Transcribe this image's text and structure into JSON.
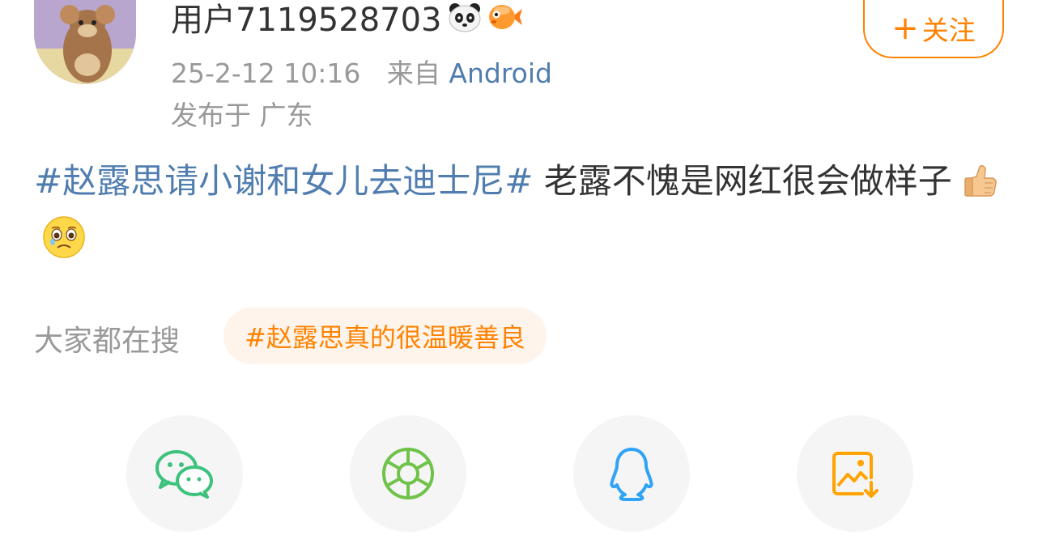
{
  "post": {
    "username": "用户7119528703",
    "timestamp": "25-2-12 10:16",
    "from_label": "来自",
    "source": "Android",
    "location": "发布于 广东",
    "topic": "#赵露思请小谢和女儿去迪士尼#",
    "body": " 老露不愧是网红很会做样子",
    "emojis": [
      "thumbs-up-emoji",
      "crying-face-emoji"
    ],
    "badges": [
      "panda-badge-icon",
      "goldfish-badge-icon"
    ]
  },
  "follow_button": {
    "plus": "+",
    "label": "关注"
  },
  "search": {
    "label": "大家都在搜",
    "hot_topic": "#赵露思真的很温暖善良"
  },
  "share": {
    "items": [
      "wechat-icon",
      "moments-icon",
      "qq-icon",
      "save-image-icon"
    ]
  },
  "colors": {
    "accent_orange": "#FF8200",
    "link_blue": "#507DAF",
    "wechat_green": "#3CC27C",
    "moments_green": "#6FC24A",
    "qq_blue": "#2FA3F5",
    "save_orange": "#FFA300"
  }
}
